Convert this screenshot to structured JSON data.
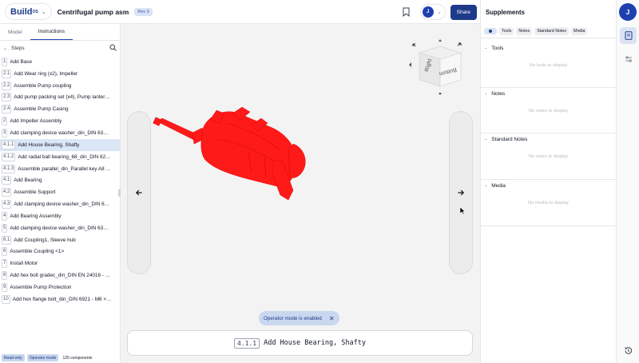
{
  "header": {
    "logo_text": "Build",
    "logo_sup": "OS",
    "doc_title": "Centrifugal pump asm",
    "revision": "Rev 3",
    "user_initial": "J",
    "share_label": "Share"
  },
  "left": {
    "tabs": [
      {
        "label": "Model",
        "active": false
      },
      {
        "label": "Instructions",
        "active": true
      }
    ],
    "steps_title": "Steps",
    "steps": [
      {
        "num": "1",
        "label": "Add Base"
      },
      {
        "num": "2.1",
        "label": "Add Wear ring (x2), Impeller"
      },
      {
        "num": "2.2",
        "label": "Assemble Pump coupling"
      },
      {
        "num": "2.3",
        "label": "Add pump packing set (x4), Pump lanter…"
      },
      {
        "num": "2.4",
        "label": "Assemble Pump Casing"
      },
      {
        "num": "2",
        "label": "Add Impeller Assembly"
      },
      {
        "num": "3",
        "label": "Add clamping device washer_din_DIN 63…"
      },
      {
        "num": "4.1.1",
        "label": "Add House Bearing, Shafty",
        "active": true
      },
      {
        "num": "4.1.2",
        "label": "Add radial ball bearing_68_din_DIN 62…"
      },
      {
        "num": "4.1.3",
        "label": "Assemble parallel_din_Parallel key A8 …"
      },
      {
        "num": "4.1",
        "label": "Add Bearing"
      },
      {
        "num": "4.2",
        "label": "Assemble Support"
      },
      {
        "num": "4.3",
        "label": "Add clamping device washer_din_DIN 6…"
      },
      {
        "num": "4",
        "label": "Add Bearing Assembly"
      },
      {
        "num": "5",
        "label": "Add clamping device washer_din_DIN 63…"
      },
      {
        "num": "6.1",
        "label": "Add Coupling1, Sleeve hub"
      },
      {
        "num": "6",
        "label": "Assemble Coupling <1>"
      },
      {
        "num": "7",
        "label": "Install Motor"
      },
      {
        "num": "8",
        "label": "Add hex bolt gradec_din_DIN EN 24016 - …"
      },
      {
        "num": "9",
        "label": "Assemble Pump Protection"
      },
      {
        "num": "10",
        "label": "Add hex flange bolt_din_DIN 6921 - M6 ×…"
      }
    ],
    "footer": {
      "badge_readonly": "Read-only",
      "badge_operator": "Operator mode",
      "component_count": "125 components"
    }
  },
  "viewport": {
    "cube_faces": {
      "front": "Right",
      "right": "Bottom"
    },
    "toast": "Operator mode is enabled",
    "caption_num": "4.1.1",
    "caption_text": "Add House Bearing, Shafty",
    "model_color": "#ff1a1a"
  },
  "supplements": {
    "title": "Supplements",
    "filters": [
      "Tools",
      "Notes",
      "Standard Notes",
      "Media"
    ],
    "sections": [
      {
        "title": "Tools",
        "empty": "No tools to display"
      },
      {
        "title": "Notes",
        "empty": "No notes to display"
      },
      {
        "title": "Standard Notes",
        "empty": "No notes to display"
      },
      {
        "title": "Media",
        "empty": "No media to display"
      }
    ]
  },
  "rail": {
    "user_initial": "J"
  },
  "colors": {
    "brand": "#1e3a8a",
    "accent": "#1e40af",
    "active_row": "#dbe6f6"
  }
}
